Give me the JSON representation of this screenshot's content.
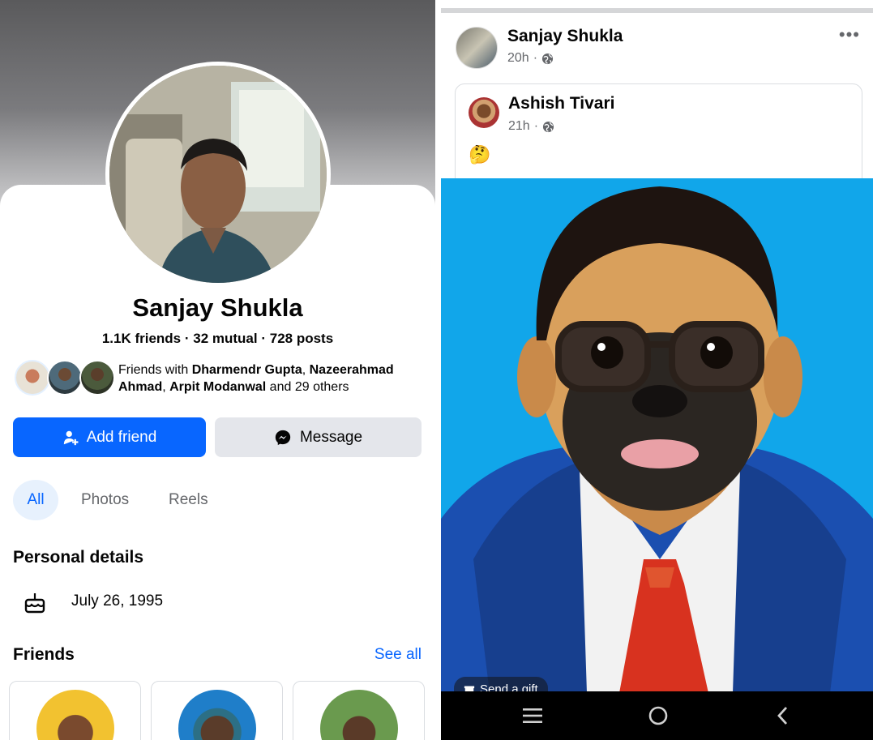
{
  "profile": {
    "name": "Sanjay Shukla",
    "friends_count": "1.1K friends",
    "mutual_count": "32 mutual",
    "posts_count": "728 posts",
    "mutuals_prefix": "Friends with ",
    "mutual_friend_1": "Dharmendr Gupta",
    "mutual_friend_2": "Nazeerahmad Ahmad",
    "mutual_friend_3": "Arpit Modanwal",
    "mutuals_suffix": " and 29 others",
    "add_friend_label": "Add friend",
    "message_label": "Message"
  },
  "tabs": [
    {
      "label": "All",
      "active": true
    },
    {
      "label": "Photos",
      "active": false
    },
    {
      "label": "Reels",
      "active": false
    }
  ],
  "personal_details": {
    "title": "Personal details",
    "birthday": "July 26, 1995"
  },
  "friends": {
    "title": "Friends",
    "see_all": "See all"
  },
  "post": {
    "author": "Sanjay Shukla",
    "time": "20h",
    "more_icon": "ellipsis-icon",
    "shared_author": "Ashish Tivari",
    "shared_time": "21h",
    "shared_text": "🤔",
    "send_gift_label": "Send a gift"
  },
  "colors": {
    "brand_blue": "#0866ff",
    "secondary_button": "#e4e6eb",
    "image_background": "#11a6ea"
  }
}
